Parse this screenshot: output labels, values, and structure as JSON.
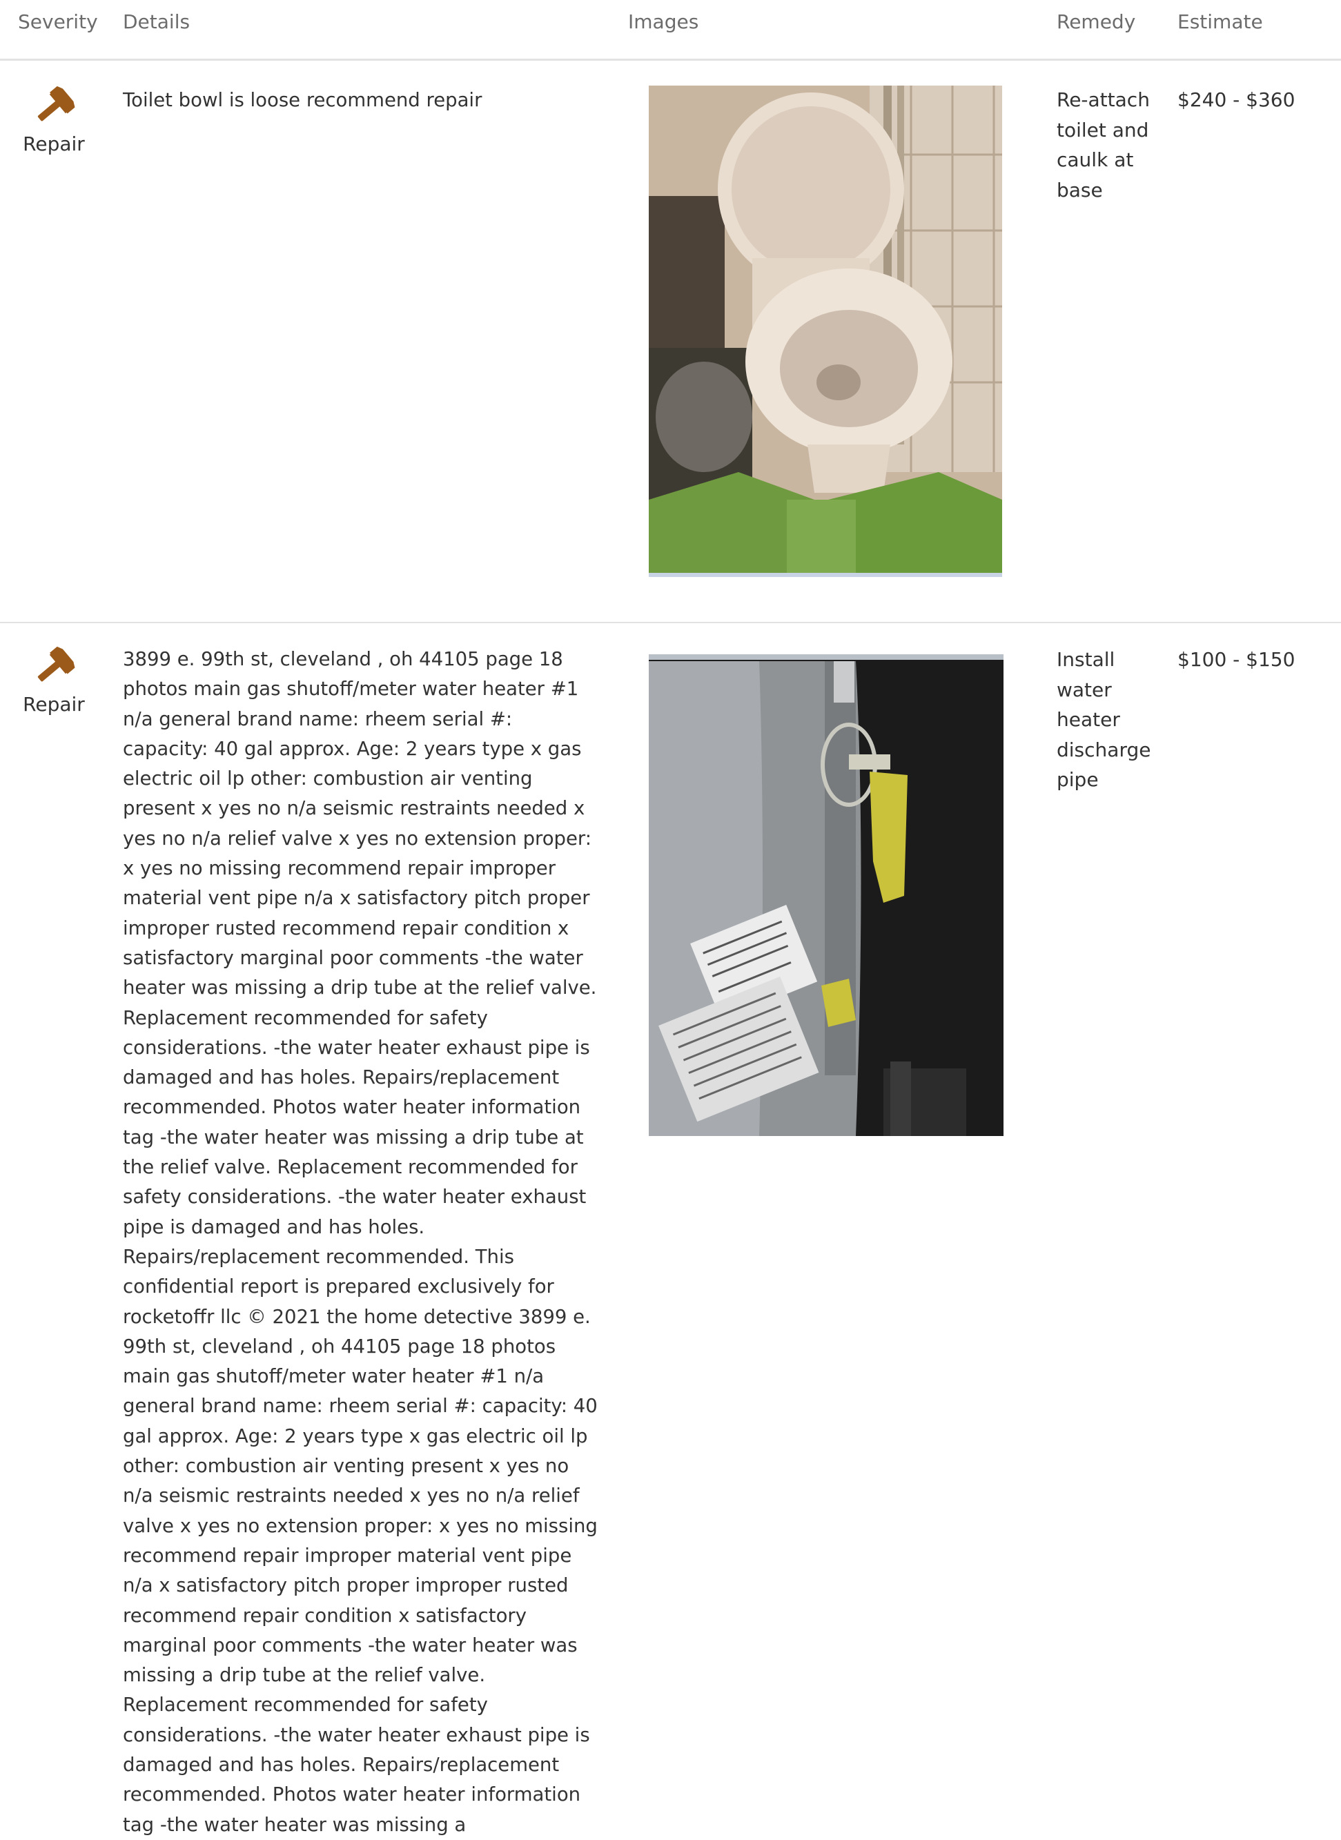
{
  "table": {
    "headers": {
      "severity": "Severity",
      "details": "Details",
      "images": "Images",
      "remedy": "Remedy",
      "estimate": "Estimate"
    },
    "rows": [
      {
        "severity_label": "Repair",
        "severity_icon": "hammer-icon",
        "details": "Toilet bowl is loose recommend repair",
        "remedy": "Re-attach toilet and caulk at base",
        "estimate": "$240 - $360"
      },
      {
        "severity_label": "Repair",
        "severity_icon": "hammer-icon",
        "details": "3899 e. 99th st, cleveland , oh 44105 page 18 photos main gas shutoff/meter water heater #1 n/a general brand name: rheem serial #: capacity: 40 gal approx. Age: 2 years type x gas electric oil lp other: combustion air venting present x yes no n/a seismic restraints needed x yes no n/a relief valve x yes no extension proper: x yes no missing recommend repair improper material vent pipe n/a x satisfactory pitch proper improper rusted recommend repair condition x satisfactory marginal poor comments -the water heater was missing a drip tube at the relief valve. Replacement recommended for safety considerations. -the water heater exhaust pipe is damaged and has holes. Repairs/replacement recommended. Photos water heater information tag -the water heater was missing a drip tube at the relief valve. Replacement recommended for safety considerations. -the water heater exhaust pipe is damaged and has holes. Repairs/replacement recommended. This confidential report is prepared exclusively for rocketoffr llc © 2021 the home detective 3899 e. 99th st, cleveland , oh 44105 page 18 photos main gas shutoff/meter water heater #1 n/a general brand name: rheem serial #: capacity: 40 gal approx. Age: 2 years type x gas electric oil lp other: combustion air venting present x yes no n/a seismic restraints needed x yes no n/a relief valve x yes no extension proper: x yes no missing recommend repair improper material vent pipe n/a x satisfactory pitch proper improper rusted recommend repair condition x satisfactory marginal poor comments -the water heater was missing a drip tube at the relief valve. Replacement recommended for safety considerations. -the water heater exhaust pipe is damaged and has holes. Repairs/replacement recommended. Photos water heater information tag -the water heater was missing a",
        "remedy": "Install water heater discharge pipe",
        "estimate": "$100 - $150"
      }
    ]
  },
  "colors": {
    "icon_brown": "#9b5a1a",
    "divider": "#e2e2e2",
    "header_text": "#6c6c6c",
    "body_text": "#333333"
  }
}
